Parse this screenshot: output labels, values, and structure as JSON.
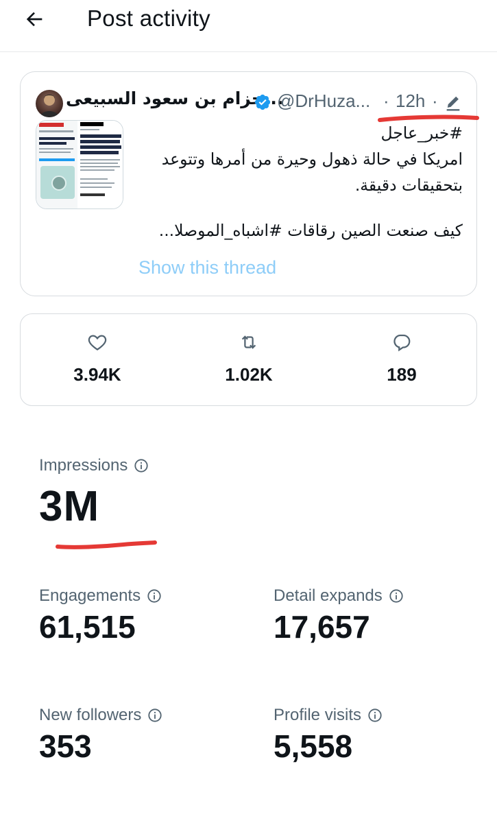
{
  "header": {
    "title": "Post activity",
    "back_icon": "arrow-left-icon"
  },
  "tweet": {
    "author_name": "...حزام بن سعود السبيعى",
    "handle": "@DrHuza...",
    "separator": "·",
    "time": "12h",
    "verified_color": "#1d9bf0",
    "lines": [
      "#خبر_عاجل",
      "امريكا في حالة ذهول وحيرة من أمرها وتتوعد",
      "بتحقيقات دقيقة.",
      "كيف صنعت الصين رقاقات #اشباه_الموصلا..."
    ],
    "thumbnail": {
      "source_left": "TECHCENTRAL",
      "headline_left": "How Huawei built a 5G smartphone",
      "source_right": "Bloomberg",
      "section_right": "Technology",
      "headline_right": "Huawei Teardown Shows Chip Breakthrough in Defiance to US Sanctions"
    },
    "show_thread": "Show this thread",
    "link_color": "#8ecdf8"
  },
  "counts": {
    "likes": "3.94K",
    "retweets": "1.02K",
    "replies": "189"
  },
  "metrics": {
    "impressions": {
      "label": "Impressions",
      "value": "3M"
    },
    "engagements": {
      "label": "Engagements",
      "value": "61,515"
    },
    "detail_expands": {
      "label": "Detail expands",
      "value": "17,657"
    },
    "new_followers": {
      "label": "New followers",
      "value": "353"
    },
    "profile_visits": {
      "label": "Profile visits",
      "value": "5,558"
    }
  },
  "annotation_color": "#e53935"
}
